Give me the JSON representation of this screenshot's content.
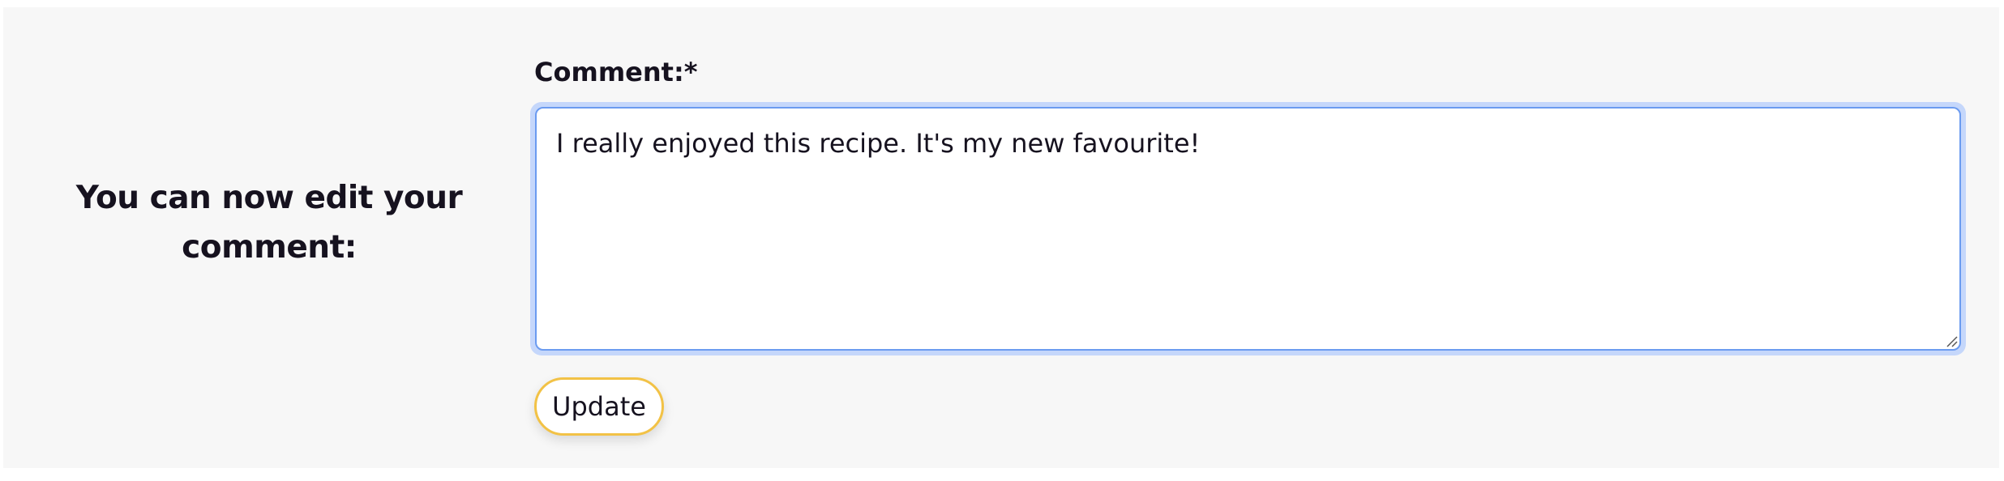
{
  "edit_section": {
    "heading": "You can now edit your comment:"
  },
  "comment_form": {
    "label": "Comment:*",
    "value": "I really enjoyed this recipe. It's my new favourite!",
    "update_label": "Update"
  },
  "colors": {
    "panel_background": "#f7f7f7",
    "focus_ring": "#c5d7fb",
    "focus_border": "#6b9bf0",
    "button_border": "#f2c246",
    "text": "#16121f"
  }
}
